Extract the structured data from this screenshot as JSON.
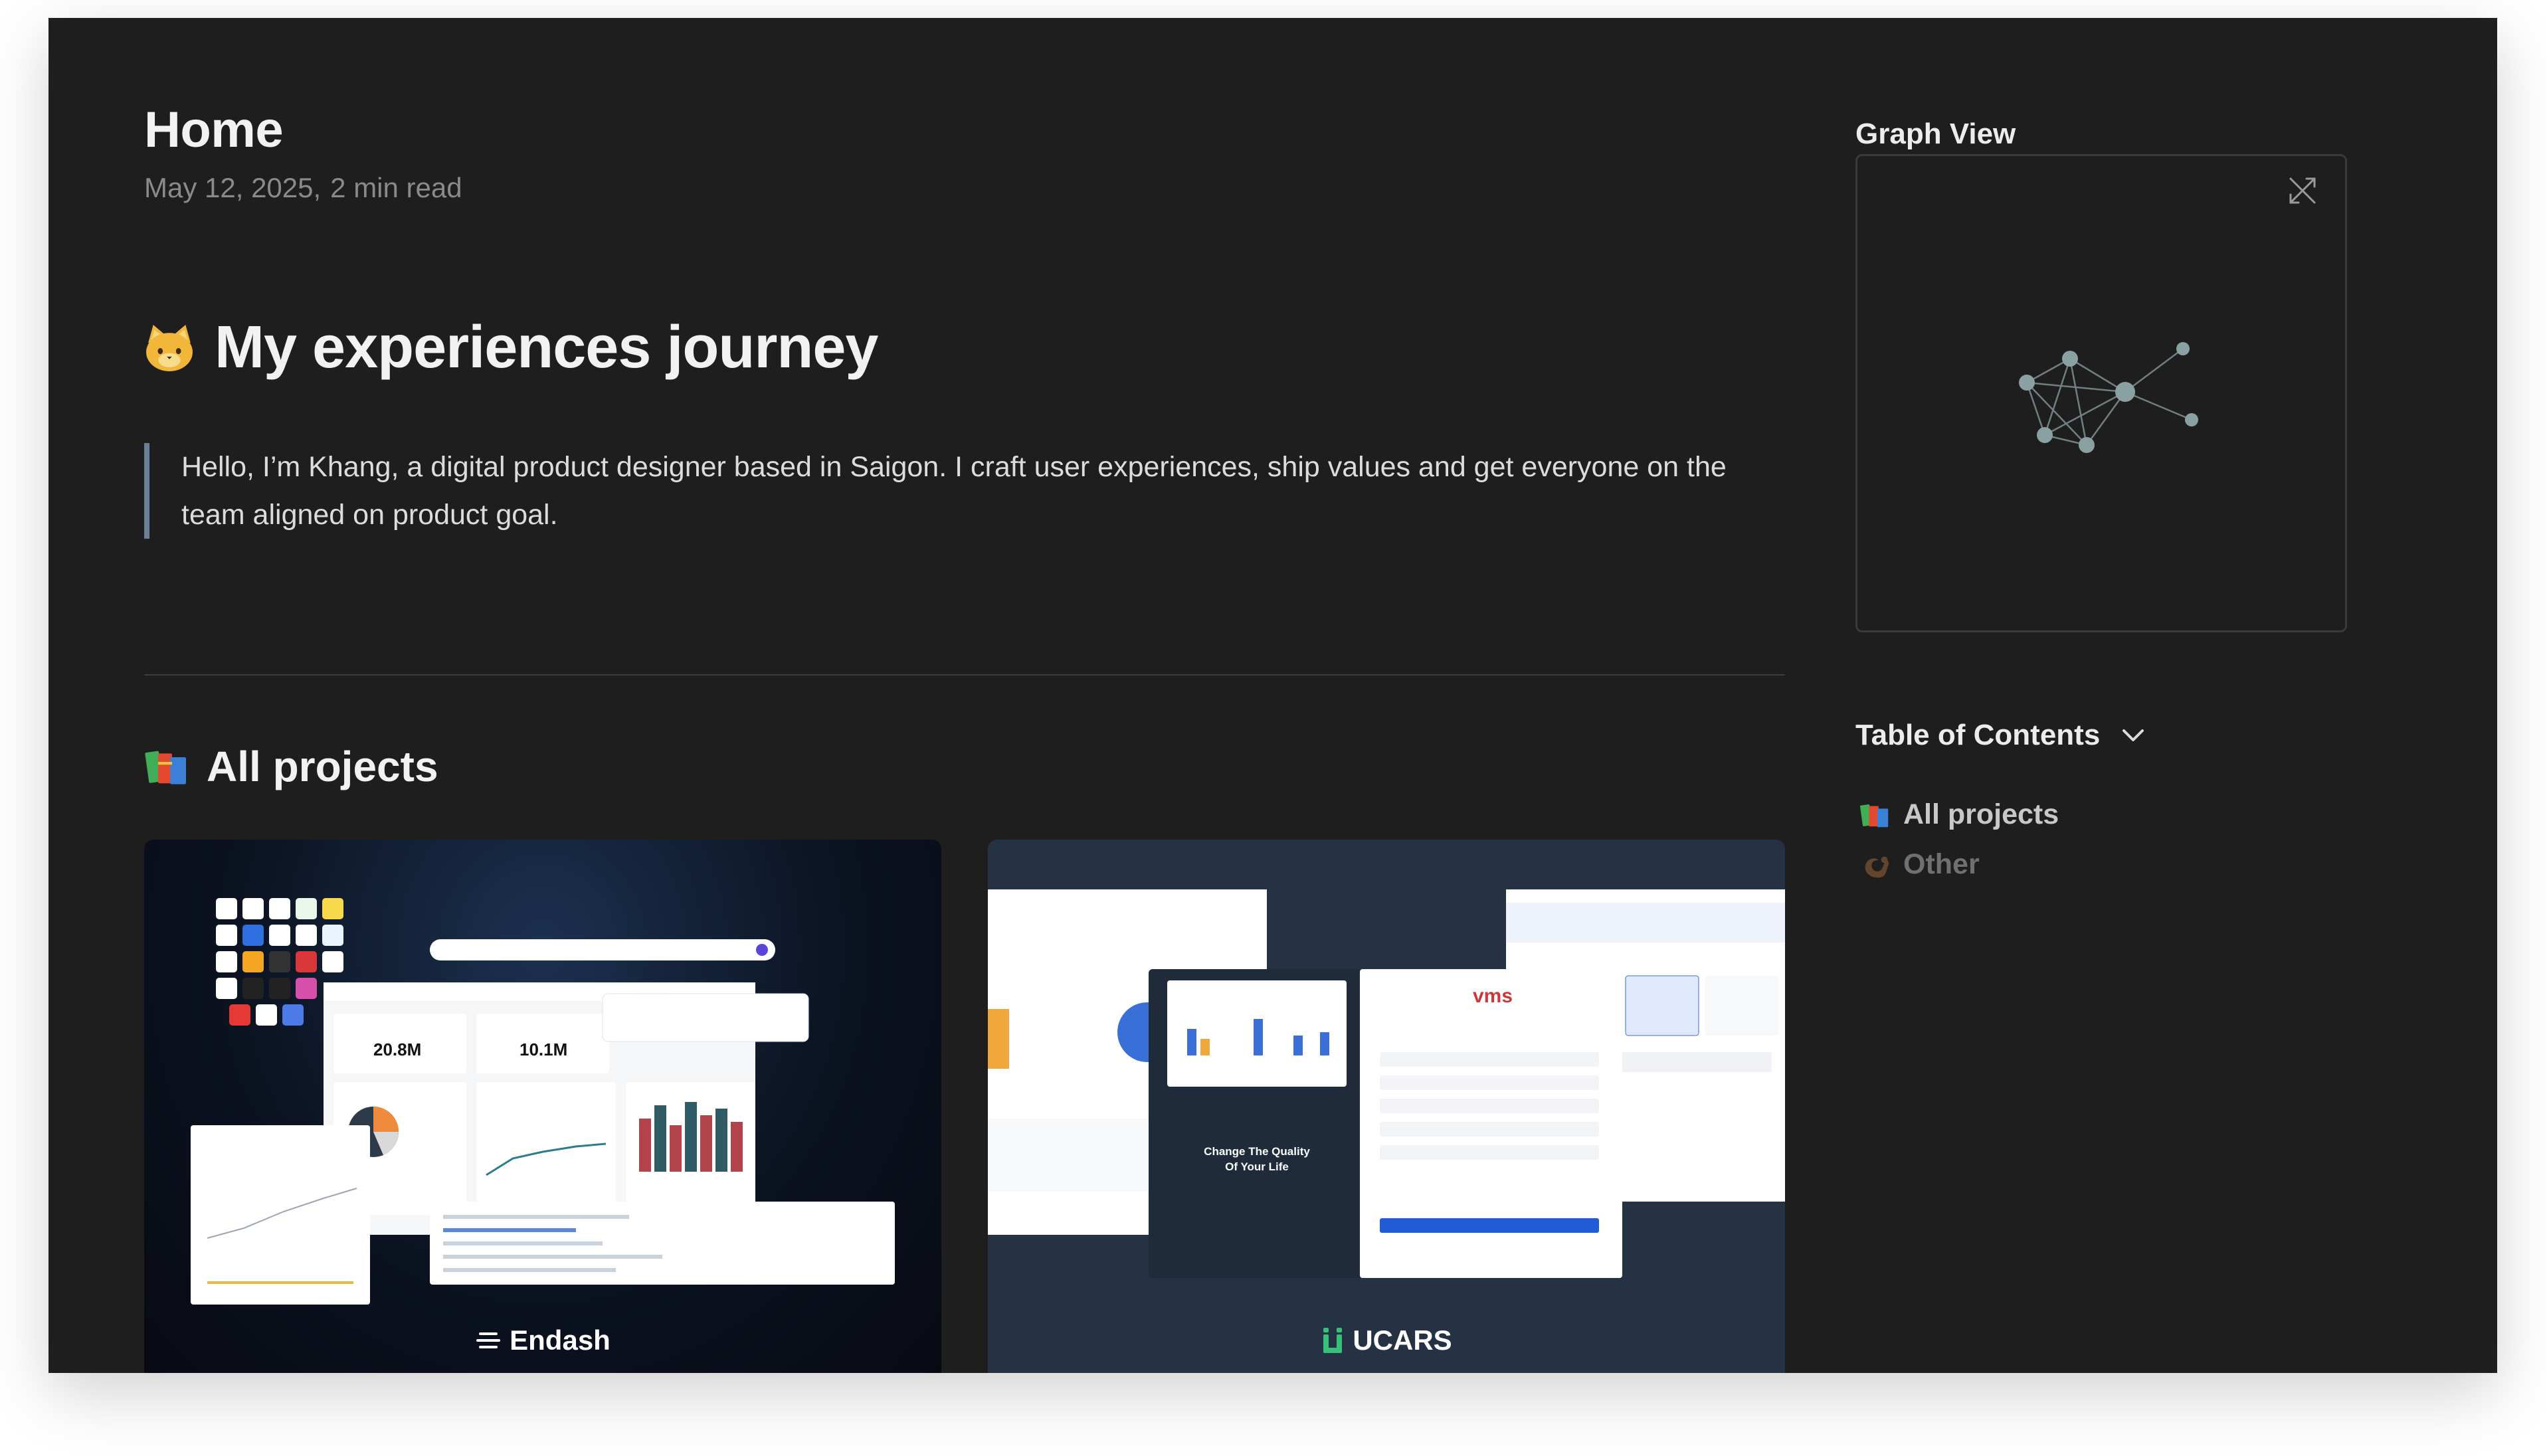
{
  "page": {
    "title": "Home",
    "date": "May 12, 2025,",
    "read_time": "2 min read"
  },
  "hero": {
    "emoji": "cat-face-icon",
    "title": "My experiences journey"
  },
  "intro": "Hello, I’m Khang, a digital product designer based in Saigon. I craft user experiences, ship values and get everyone on the team aligned on product goal.",
  "projects": {
    "emoji": "books-icon",
    "heading": "All projects",
    "cards": [
      {
        "brand": "Endash",
        "brand_icon": "endash-logo-icon"
      },
      {
        "brand": "UCARS",
        "brand_icon": "ucars-logo-icon"
      }
    ]
  },
  "sidebar": {
    "graph_title": "Graph View",
    "toc_title": "Table of Contents",
    "toc_items": [
      {
        "label": "All projects",
        "icon": "books-icon"
      },
      {
        "label": "Other",
        "icon": "squirrel-icon"
      }
    ]
  },
  "colors": {
    "background": "#1e1e1e",
    "text": "#f2f2f2",
    "muted": "#8a8a8a",
    "accent_border": "#6b7f99",
    "graph_node": "#8aa1a3"
  }
}
